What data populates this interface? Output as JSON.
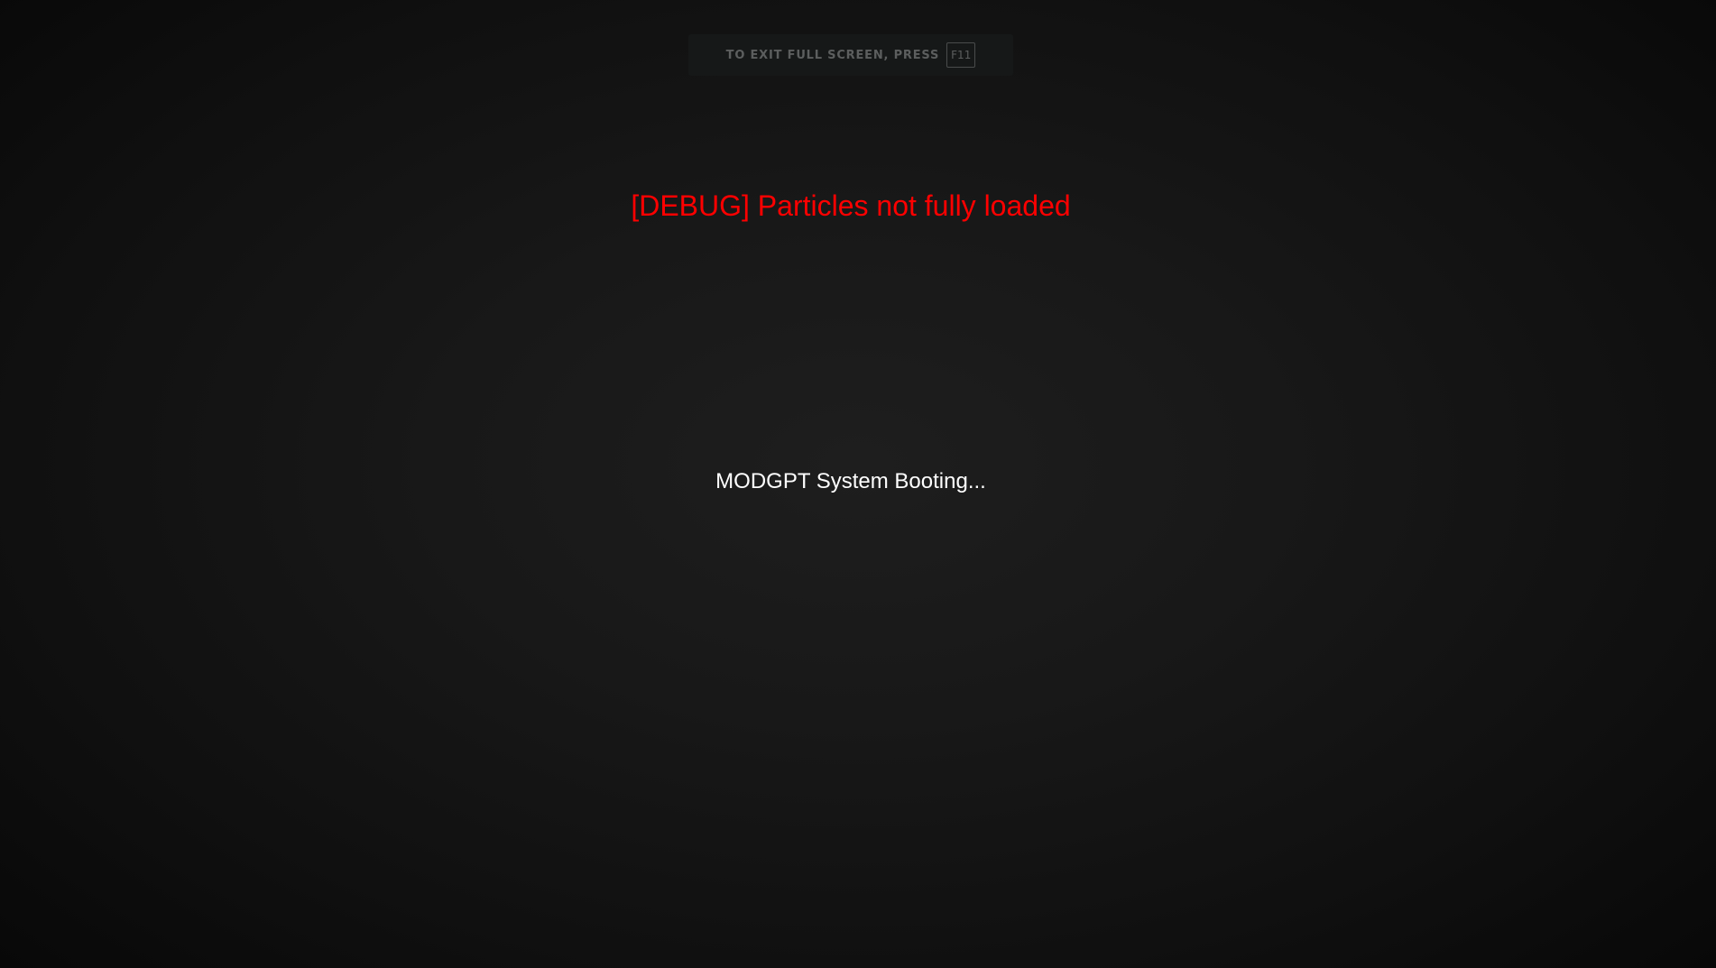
{
  "fullscreen_notice": {
    "text": "To exit full screen, press",
    "key": "F11"
  },
  "debug_message": "[DEBUG] Particles not fully loaded",
  "boot_message": "MODGPT System Booting...",
  "colors": {
    "debug_text": "#ff0000",
    "boot_text": "#ffffff",
    "background": "#181818"
  }
}
